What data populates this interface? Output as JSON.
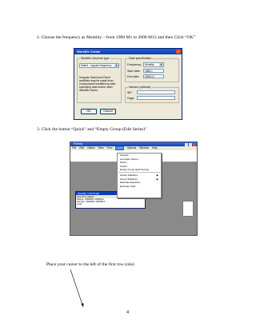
{
  "step2": "2.   Choose the frequency as Monthly  – from 1980 M1 to 2008 M12 and then Click “OK”",
  "step3": "3.   Click the button “Quick” and “Empty Group (Edit Series)”",
  "instruction": "Place your cursor to the left of the first row (obs)",
  "page_number": "4",
  "dialog": {
    "title": "Workfile Create",
    "structure_label": "Workfile structure type",
    "structure_value": "Dated - regular frequency",
    "description": "Irregular Dated and Panel workfiles may be made from Unstructured workfiles by later specifying date and/or other identifier series.",
    "date_spec_label": "Date specification",
    "frequency_label": "Frequency:",
    "frequency_value": "Monthly",
    "start_label": "Start date:",
    "start_value": "1980:1",
    "end_label": "End date:",
    "end_value": "2008:12",
    "names_label": "Names (optional)",
    "wf_label": "WF:",
    "page_label": "Page:",
    "ok": "OK",
    "cancel": "Cancel"
  },
  "eviews": {
    "title": "EViews",
    "menus": [
      "File",
      "Edit",
      "Object",
      "View",
      "Proc",
      "Quick",
      "Options",
      "Window",
      "Help"
    ],
    "quick_menu": [
      {
        "label": "Sample...",
        "submenu": false
      },
      {
        "label": "Generate Series...",
        "submenu": false
      },
      {
        "label": "Show...",
        "submenu": false
      },
      {
        "label": "Graph...",
        "submenu": false
      },
      {
        "label": "Empty Group (Edit Series)",
        "submenu": false
      },
      {
        "sep": true
      },
      {
        "label": "Series Statistics",
        "submenu": true
      },
      {
        "label": "Group Statistics",
        "submenu": true
      },
      {
        "label": "Estimate Equation...",
        "submenu": false
      },
      {
        "label": "Estimate VAR...",
        "submenu": false
      }
    ],
    "workfile": {
      "title": "Workfile: UNTITLED",
      "toolbar": "View  Proc  Object",
      "range": "Range:  1980M01 2008M12",
      "sample": "Sample:  1980M01 2008M12",
      "objects": "resid"
    }
  }
}
